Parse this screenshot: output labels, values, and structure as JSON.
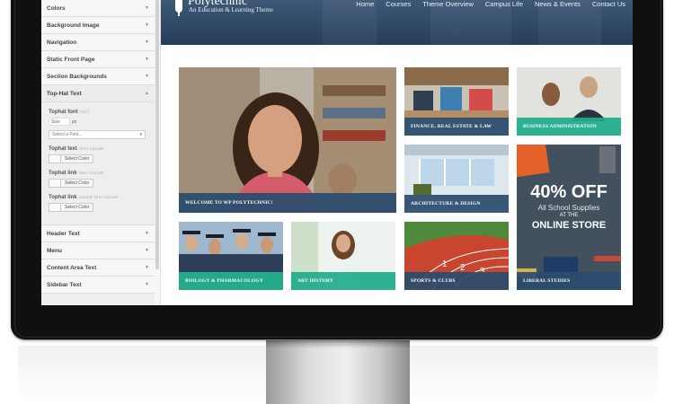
{
  "customizer": {
    "sections_top": [
      {
        "label": "Colors"
      },
      {
        "label": "Background Image"
      },
      {
        "label": "Navigation"
      },
      {
        "label": "Static Front Page"
      },
      {
        "label": "Section Backgrounds"
      }
    ],
    "open_section": {
      "label": "Top-Hat Text"
    },
    "font": {
      "label": "Tophat font",
      "tag": "TEXT",
      "size_placeholder": "Size",
      "unit": "px",
      "select_placeholder": "Select a Font..."
    },
    "colors": [
      {
        "label": "Tophat text",
        "tag": "TEXT COLOR",
        "button": "Select Color"
      },
      {
        "label": "Tophat link",
        "tag": "TEXT COLOR",
        "button": "Select Color"
      },
      {
        "label": "Tophat link",
        "tag": "HOVER TEXT COLOR",
        "button": "Select Color"
      }
    ],
    "sections_bottom": [
      {
        "label": "Header Text"
      },
      {
        "label": "Menu"
      },
      {
        "label": "Content Area Text"
      },
      {
        "label": "Sidebar Text"
      }
    ]
  },
  "site": {
    "title": "Polytechnic",
    "tagline": "An Education & Learning Theme",
    "nav": [
      "Home",
      "Courses",
      "Theme Overview",
      "Campus Life",
      "News & Events",
      "Contact Us"
    ],
    "tiles": {
      "welcome": "WELCOME TO WP POLYTECHNIC!",
      "finance": "FINANCE, REAL ESTATE & LAW",
      "business": "BUSINESS ADMINISTRATION",
      "architecture": "ARCHITECTURE & DESIGN",
      "biology": "BIOLOGY & PHARMACOLOGY",
      "art": "ART HISTORY",
      "sports": "SPORTS & CLUBS",
      "liberal": "LIBERAL STUDIES"
    },
    "promo": {
      "line1": "40% OFF",
      "line2": "All School Supplies",
      "line3": "AT THE",
      "line4": "ONLINE STORE"
    }
  },
  "colors": {
    "header": "#2e4866",
    "caption_blue": "#2a4c6e",
    "caption_teal": "#20ac8c",
    "promo_bg": "#43505e"
  }
}
